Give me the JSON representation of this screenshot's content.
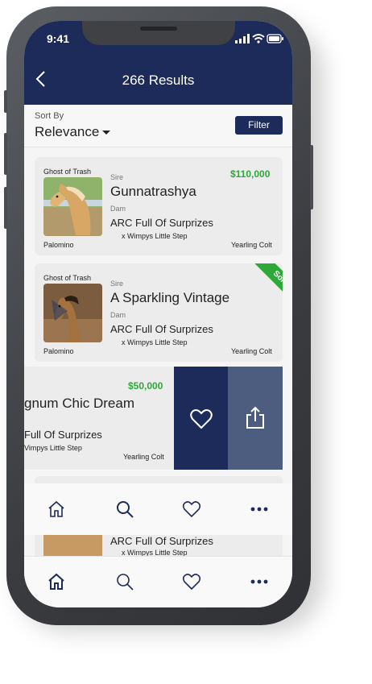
{
  "status_bar": {
    "time": "9:41"
  },
  "header": {
    "title": "266 Results"
  },
  "sort": {
    "label": "Sort By",
    "value": "Relevance",
    "filter_label": "Filter"
  },
  "listings": [
    {
      "farm": "Ghost of Trash",
      "sire_label": "Sire",
      "sire": "Gunnatrashya",
      "dam_label": "Dam",
      "dam": "ARC Full Of Surprizes",
      "granddam": "x Wimpys Little Step",
      "color": "Palomino",
      "age": "Yearling Colt",
      "price": "$110,000"
    },
    {
      "farm": "Ghost of Trash",
      "sire_label": "Sire",
      "sire": "A Sparkling Vintage",
      "dam_label": "Dam",
      "dam": "ARC Full Of Surprizes",
      "granddam": "x Wimpys Little Step",
      "color": "Palomino",
      "age": "Yearling Colt",
      "badge": "Sold"
    },
    {
      "sire": "gnum Chic Dream",
      "dam": "Full Of Surprizes",
      "granddam": "Vimpys Little Step",
      "age": "Yearling Colt",
      "price": "$50,000"
    },
    {
      "dam": "ARC Full Of Surprizes",
      "granddam": "x Wimpys Little Step"
    }
  ],
  "swipe_actions": [
    "heart-icon",
    "share-icon"
  ],
  "tab_bars": [
    {
      "items": [
        "home-icon",
        "search-icon",
        "heart-icon",
        "more-icon"
      ]
    },
    {
      "items": [
        "home-icon",
        "search-icon",
        "heart-icon",
        "more-icon"
      ]
    }
  ],
  "colors": {
    "brand": "#1c2b5a",
    "price": "#2fa83a",
    "share_action": "#4d5d80"
  }
}
